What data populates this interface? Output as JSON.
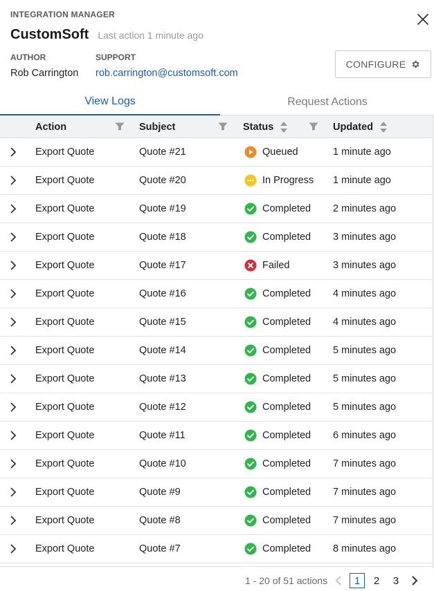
{
  "header": {
    "eyebrow": "INTEGRATION MANAGER",
    "title": "CustomSoft",
    "last_action": "Last action 1 minute ago",
    "close_icon": "close-icon"
  },
  "meta": {
    "author_label": "AUTHOR",
    "author_value": "Rob Carrington",
    "support_label": "SUPPORT",
    "support_value": "rob.carrington@customsoft.com"
  },
  "configure": {
    "label": "CONFIGURE",
    "icon": "gear-icon"
  },
  "tabs": [
    {
      "label": "View Logs",
      "active": true
    },
    {
      "label": "Request Actions",
      "active": false
    }
  ],
  "table": {
    "columns": [
      {
        "label": "Action",
        "filter": true,
        "sort": false
      },
      {
        "label": "Subject",
        "filter": true,
        "sort": false
      },
      {
        "label": "Status",
        "filter": true,
        "sort": true
      },
      {
        "label": "Updated",
        "filter": false,
        "sort": true
      }
    ],
    "rows": [
      {
        "action": "Export Quote",
        "subject": "Quote #21",
        "status": "Queued",
        "updated": "1 minute ago"
      },
      {
        "action": "Export Quote",
        "subject": "Quote #20",
        "status": "In Progress",
        "updated": "1 minute ago"
      },
      {
        "action": "Export Quote",
        "subject": "Quote #19",
        "status": "Completed",
        "updated": "2 minutes ago"
      },
      {
        "action": "Export Quote",
        "subject": "Quote #18",
        "status": "Completed",
        "updated": "3 minutes ago"
      },
      {
        "action": "Export Quote",
        "subject": "Quote #17",
        "status": "Failed",
        "updated": "3 minutes ago"
      },
      {
        "action": "Export Quote",
        "subject": "Quote #16",
        "status": "Completed",
        "updated": "4 minutes ago"
      },
      {
        "action": "Export Quote",
        "subject": "Quote #15",
        "status": "Completed",
        "updated": "4 minutes ago"
      },
      {
        "action": "Export Quote",
        "subject": "Quote #14",
        "status": "Completed",
        "updated": "5 minutes ago"
      },
      {
        "action": "Export Quote",
        "subject": "Quote #13",
        "status": "Completed",
        "updated": "5 minutes ago"
      },
      {
        "action": "Export Quote",
        "subject": "Quote #12",
        "status": "Completed",
        "updated": "5 minutes ago"
      },
      {
        "action": "Export Quote",
        "subject": "Quote #11",
        "status": "Completed",
        "updated": "6 minutes ago"
      },
      {
        "action": "Export Quote",
        "subject": "Quote #10",
        "status": "Completed",
        "updated": "7 minutes ago"
      },
      {
        "action": "Export Quote",
        "subject": "Quote #9",
        "status": "Completed",
        "updated": "7 minutes ago"
      },
      {
        "action": "Export Quote",
        "subject": "Quote #8",
        "status": "Completed",
        "updated": "7 minutes ago"
      },
      {
        "action": "Export Quote",
        "subject": "Quote #7",
        "status": "Completed",
        "updated": "8 minutes ago"
      }
    ]
  },
  "status_styles": {
    "Queued": {
      "icon": "play-circle-icon",
      "color": "#f08a24"
    },
    "In Progress": {
      "icon": "ellipsis-circle-icon",
      "color": "#f5c518"
    },
    "Completed": {
      "icon": "check-circle-icon",
      "color": "#2eb84b"
    },
    "Failed": {
      "icon": "x-circle-icon",
      "color": "#d92b3a"
    }
  },
  "pagination": {
    "range_text": "1 - 20 of 51 actions",
    "pages": [
      "1",
      "2",
      "3"
    ],
    "current": "1"
  },
  "colors": {
    "accent": "#1a5bcc",
    "header_bg": "#f1f2f3"
  }
}
